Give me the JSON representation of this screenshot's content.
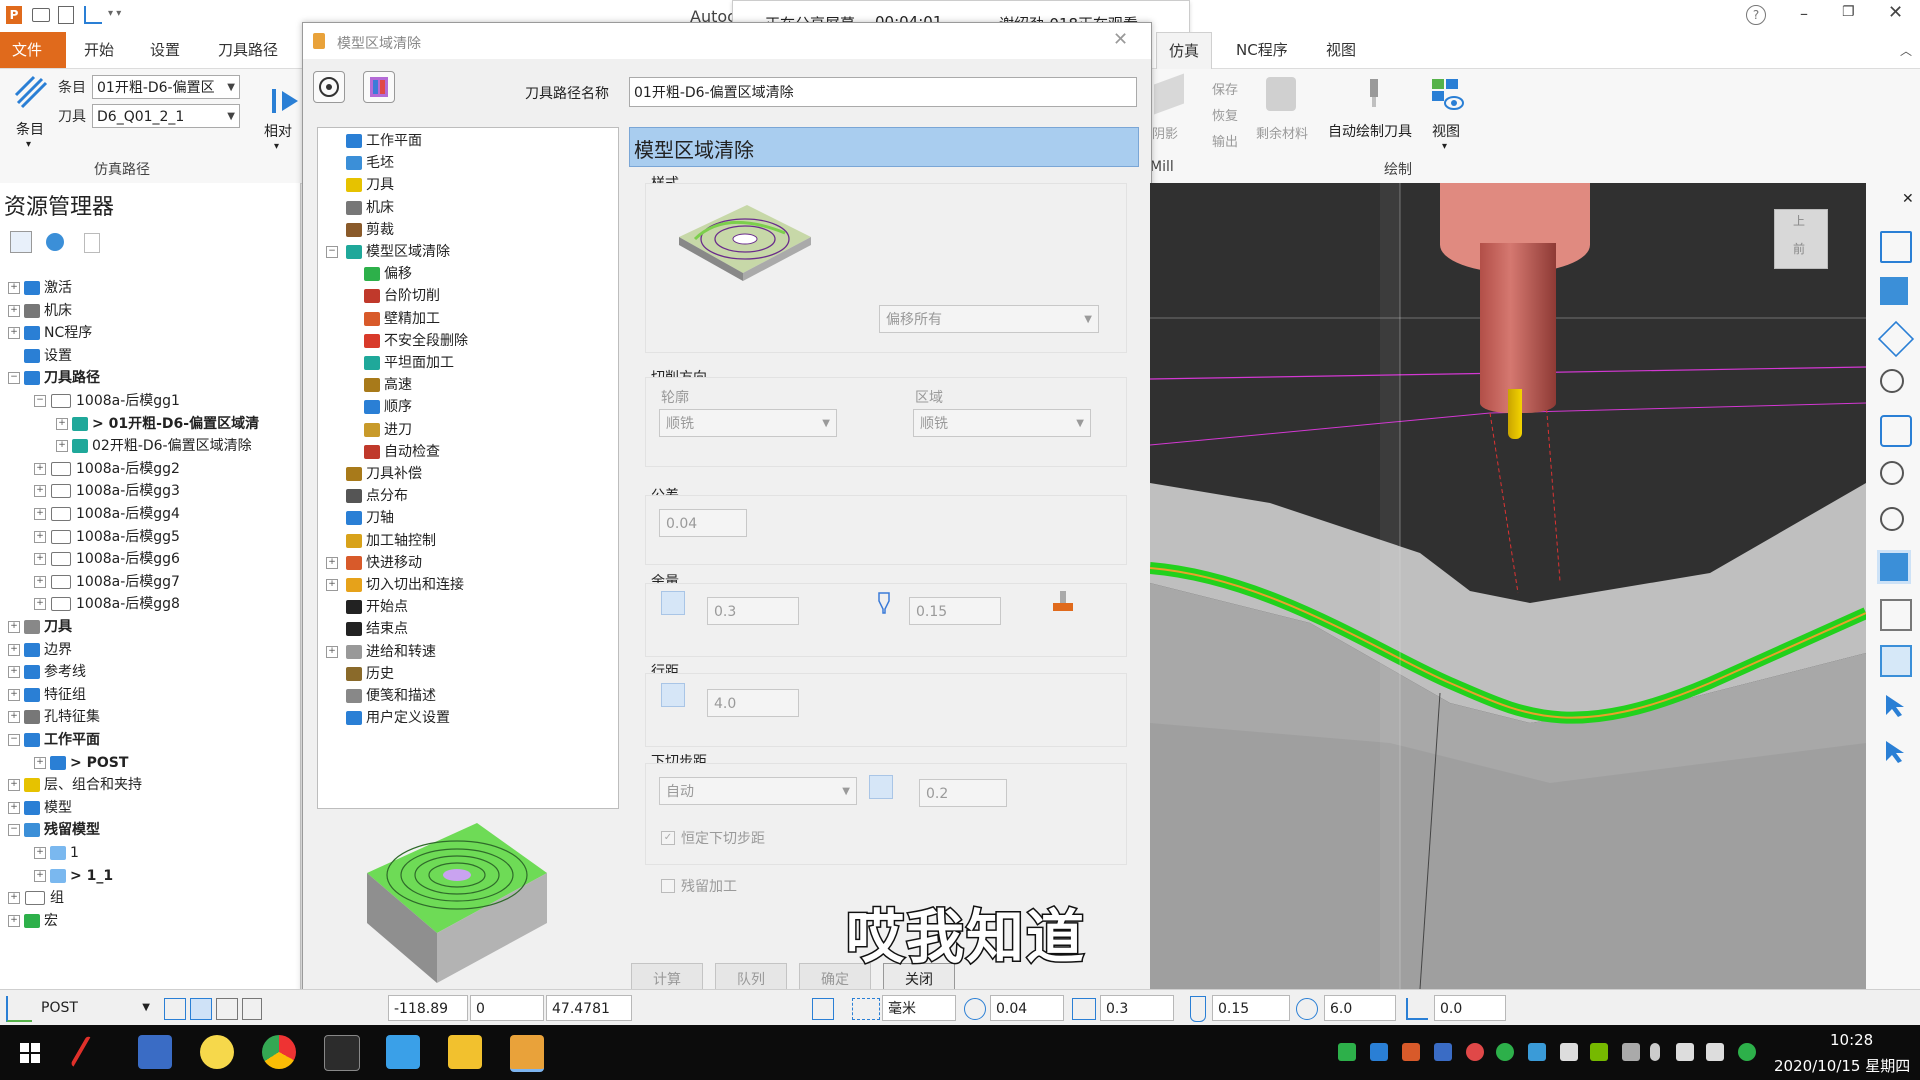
{
  "app": {
    "title": "Autoc"
  },
  "share": {
    "label": "正在分享屏幕",
    "timer": "00:04:01",
    "viewer": "谢绍劲-018正在观看"
  },
  "ribbon_tabs": [
    "文件",
    "开始",
    "设置",
    "刀具路径",
    "仿真",
    "NC程序",
    "视图"
  ],
  "ribbon": {
    "item_label": "条目",
    "item_value": "01开粗-D6-偏置区",
    "tool_label": "刀具",
    "tool_value": "D6_Q01_2_1",
    "big_item": "条目",
    "relative": "相对",
    "group_sim": "仿真路径",
    "save": "保存",
    "restore": "恢复",
    "output": "输出",
    "shadow": "阴影",
    "remain": "剩余材料",
    "mill": "Mill",
    "auto_draw": "自动绘制刀具",
    "view": "视图",
    "group_draw": "绘制"
  },
  "explorer": {
    "title": "资源管理器",
    "rows": [
      {
        "label": "激活",
        "bold": false
      },
      {
        "label": "机床",
        "bold": false
      },
      {
        "label": "NC程序",
        "bold": false
      },
      {
        "label": "设置",
        "bold": false
      },
      {
        "label": "刀具路径",
        "bold": true
      },
      {
        "label": "1008a-后模gg1",
        "bold": false
      },
      {
        "label": "> 01开粗-D6-偏置区域清",
        "bold": true
      },
      {
        "label": "02开粗-D6-偏置区域清除",
        "bold": false
      },
      {
        "label": "1008a-后模gg2",
        "bold": false
      },
      {
        "label": "1008a-后模gg3",
        "bold": false
      },
      {
        "label": "1008a-后模gg4",
        "bold": false
      },
      {
        "label": "1008a-后模gg5",
        "bold": false
      },
      {
        "label": "1008a-后模gg6",
        "bold": false
      },
      {
        "label": "1008a-后模gg7",
        "bold": false
      },
      {
        "label": "1008a-后模gg8",
        "bold": false
      },
      {
        "label": "刀具",
        "bold": true
      },
      {
        "label": "边界",
        "bold": false
      },
      {
        "label": "参考线",
        "bold": false
      },
      {
        "label": "特征组",
        "bold": false
      },
      {
        "label": "孔特征集",
        "bold": false
      },
      {
        "label": "工作平面",
        "bold": true
      },
      {
        "label": "> POST",
        "bold": true
      },
      {
        "label": "层、组合和夹持",
        "bold": false
      },
      {
        "label": "模型",
        "bold": false
      },
      {
        "label": "残留模型",
        "bold": true
      },
      {
        "label": "1",
        "bold": false
      },
      {
        "label": "> 1_1",
        "bold": true
      },
      {
        "label": "组",
        "bold": false
      },
      {
        "label": "宏",
        "bold": false
      }
    ]
  },
  "dialog": {
    "title": "模型区域清除",
    "path_name_label": "刀具路径名称",
    "path_name_value": "01开粗-D6-偏置区域清除",
    "header": "模型区域清除",
    "tree": [
      "工作平面",
      "毛坯",
      "刀具",
      "机床",
      "剪裁",
      "模型区域清除",
      "偏移",
      "台阶切削",
      "壁精加工",
      "不安全段删除",
      "平坦面加工",
      "高速",
      "顺序",
      "进刀",
      "自动检查",
      "刀具补偿",
      "点分布",
      "刀轴",
      "加工轴控制",
      "快进移动",
      "切入切出和连接",
      "开始点",
      "结束点",
      "进给和转速",
      "历史",
      "便笺和描述",
      "用户定义设置"
    ],
    "style_label": "样式",
    "style_value": "偏移所有",
    "cut_dir_label": "切削方向",
    "contour_label": "轮廓",
    "contour_value": "顺铣",
    "area_label": "区域",
    "area_value": "顺铣",
    "tolerance_label": "公差",
    "tolerance_value": "0.04",
    "allowance_label": "余量",
    "allowance_radial": "0.3",
    "allowance_axial": "0.15",
    "stepover_label": "行距",
    "stepover_value": "4.0",
    "stepdown_label": "下切步距",
    "stepdown_mode": "自动",
    "stepdown_value": "0.2",
    "const_stepdown": "恒定下切步距",
    "rest_machining": "残留加工",
    "btn_calc": "计算",
    "btn_queue": "队列",
    "btn_ok": "确定",
    "btn_close": "关闭"
  },
  "viewcube": {
    "top": "上",
    "front": "前"
  },
  "status": {
    "workplane": "POST",
    "x": "-118.89",
    "y": "0",
    "z": "47.4781",
    "units": "毫米",
    "tolerance": "0.04",
    "allowance": "0.3",
    "axial_allowance": "0.15",
    "diameter": "6.0",
    "value": "0.0"
  },
  "subtitle": "哎我知道",
  "clock": {
    "time": "10:28",
    "date": "2020/10/15 星期四"
  },
  "colors": {
    "accent": "#e06a1c",
    "toolpath": "#22d11c",
    "tool": "#c9716a",
    "holder": "#e6c200",
    "header": "#9ec5ea"
  }
}
